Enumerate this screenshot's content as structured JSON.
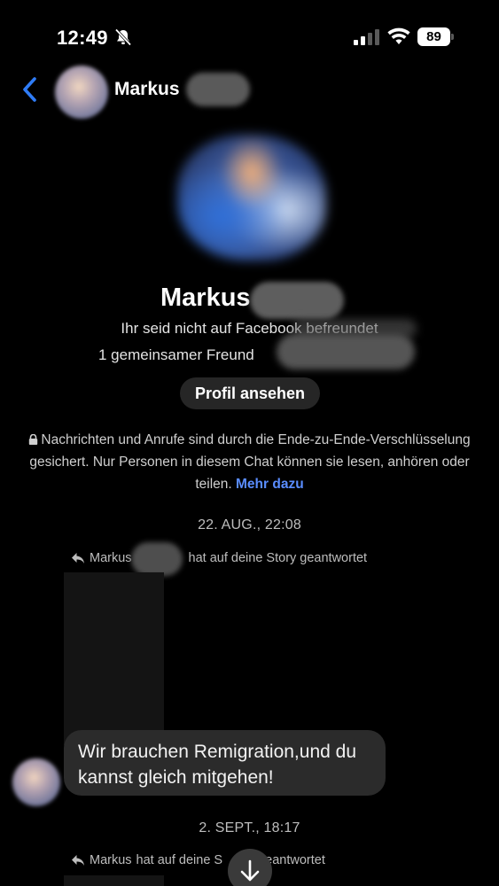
{
  "status_bar": {
    "time": "12:49",
    "battery": "89",
    "icons": [
      "bell-slash-icon",
      "signal-icon",
      "wifi-icon",
      "battery-icon"
    ]
  },
  "header": {
    "name": "Markus",
    "back_icon": "chevron-left-icon"
  },
  "profile": {
    "name": "Markus",
    "friend_status": "Ihr seid nicht auf Facebook befreundet",
    "mutual_friends": "1 gemeinsamer Freund",
    "view_profile_label": "Profil ansehen"
  },
  "encryption": {
    "notice": "Nachrichten und Anrufe sind durch die Ende-zu-Ende-Verschlüsselung gesichert. Nur Personen in diesem Chat können sie lesen, anhören oder teilen.",
    "more_link": "Mehr dazu"
  },
  "messages": [
    {
      "timestamp": "22. AUG., 22:08",
      "story_reply_name": "Markus",
      "story_reply_text": "hat auf deine Story geantwortet",
      "text": "Wir brauchen Remigration,und du kannst gleich mitgehen!"
    },
    {
      "timestamp": "2. SEPT., 18:17",
      "story_reply_name": "Markus",
      "story_reply_text_a": "hat auf deine S",
      "story_reply_text_b": "geantwortet"
    }
  ],
  "colors": {
    "background": "#000000",
    "link": "#5a8dff",
    "bubble": "#2b2b2b",
    "back_arrow": "#2f7cf6"
  }
}
